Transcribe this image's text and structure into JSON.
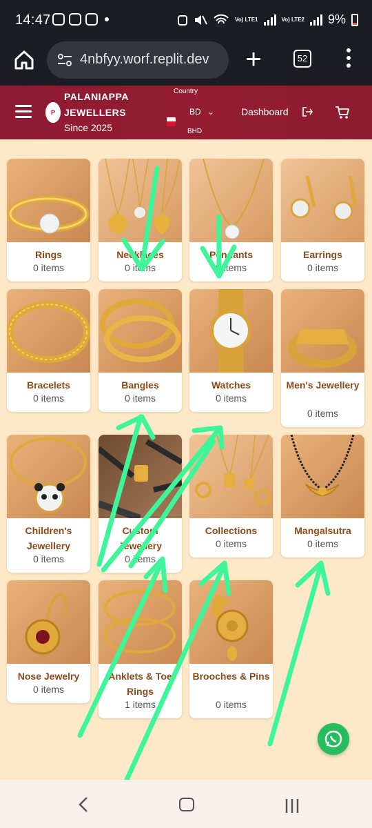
{
  "status_bar": {
    "time": "14:47",
    "battery": "9%",
    "lte1": "Vo) LTE1",
    "lte2": "Vo) LTE2"
  },
  "browser": {
    "url": "4nbfyy.worf.replit.dev",
    "tab_count": "52"
  },
  "header": {
    "brand_line1": "PALANIAPPA",
    "brand_line2": "JEWELLERS",
    "brand_line3": "Since 2025",
    "logo_letter": "P",
    "country_label": "Country",
    "country_code": "BD",
    "currency": "BHD",
    "dashboard_label": "Dashboard"
  },
  "categories": [
    {
      "name": "Rings",
      "count": "0 items"
    },
    {
      "name": "Necklaces",
      "count": "0 items"
    },
    {
      "name": "Pendants",
      "count": "0 items"
    },
    {
      "name": "Earrings",
      "count": "0 items"
    },
    {
      "name": "Bracelets",
      "count": "0 items"
    },
    {
      "name": "Bangles",
      "count": "0 items"
    },
    {
      "name": "Watches",
      "count": "0 items"
    },
    {
      "name": "Men's Jewellery",
      "count": "0 items"
    },
    {
      "name": "Children's Jewellery",
      "count": "0 items"
    },
    {
      "name": "Custom Jewellery",
      "count": "0 items"
    },
    {
      "name": "Collections",
      "count": "0 items"
    },
    {
      "name": "Mangalsutra",
      "count": "0 items"
    },
    {
      "name": "Nose Jewelry",
      "count": "0 items"
    },
    {
      "name": "Anklets & Toe Rings",
      "count": "1 items"
    },
    {
      "name": "Brooches & Pins",
      "count": "0 items"
    }
  ],
  "colors": {
    "header_bg": "#8e1a33",
    "page_bg": "#fde9c8",
    "category_title": "#8c4a18",
    "annotation_arrow": "#3ef59a",
    "whatsapp": "#26bd5c"
  },
  "icons": [
    "home-icon",
    "tune-icon",
    "plus-icon",
    "tabs-icon",
    "more-vert-icon",
    "hamburger-icon",
    "logout-icon",
    "cart-icon",
    "whatsapp-icon",
    "nav-back-icon",
    "nav-home-icon",
    "nav-recents-icon"
  ]
}
